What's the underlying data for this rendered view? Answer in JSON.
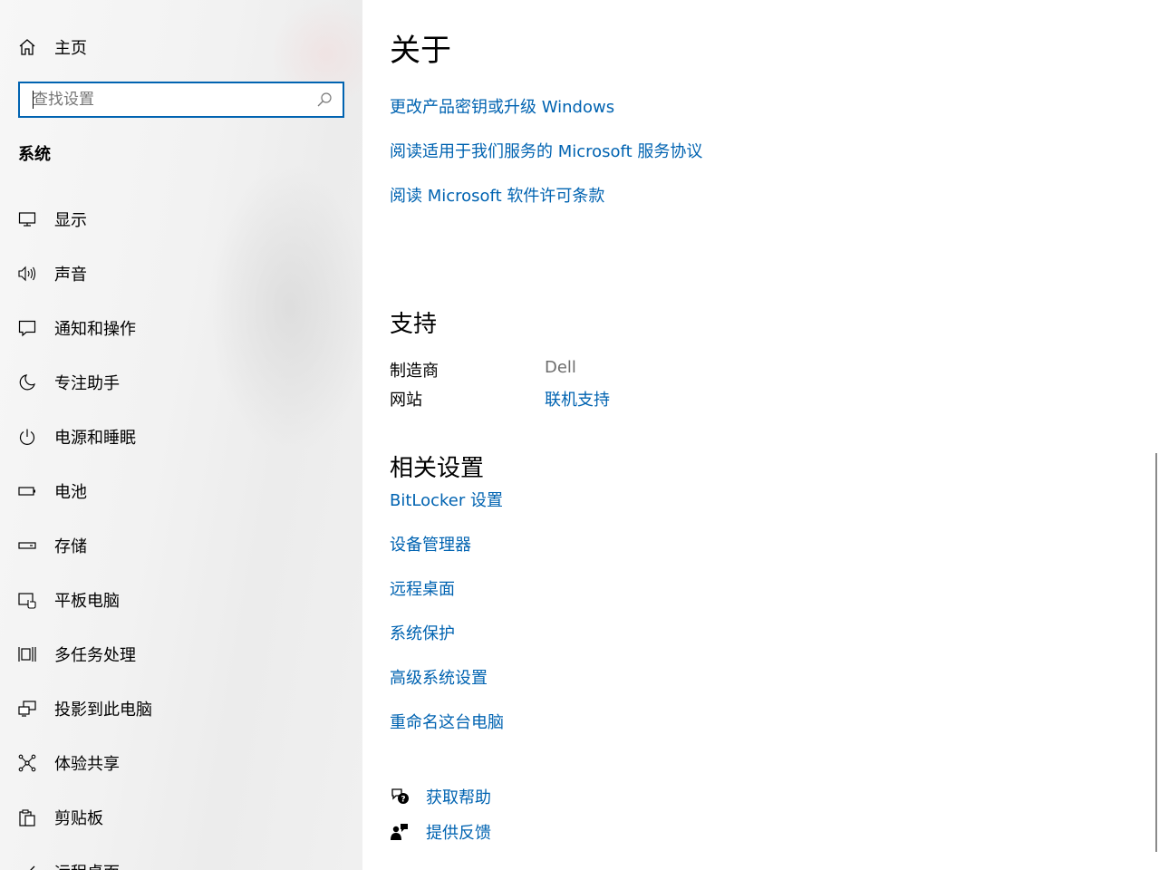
{
  "sidebar": {
    "home_label": "主页",
    "search_placeholder": "查找设置",
    "section_title": "系统",
    "items": [
      {
        "label": "显示",
        "icon": "monitor-icon"
      },
      {
        "label": "声音",
        "icon": "speaker-icon"
      },
      {
        "label": "通知和操作",
        "icon": "notification-icon"
      },
      {
        "label": "专注助手",
        "icon": "moon-icon"
      },
      {
        "label": "电源和睡眠",
        "icon": "power-icon"
      },
      {
        "label": "电池",
        "icon": "battery-icon"
      },
      {
        "label": "存储",
        "icon": "storage-icon"
      },
      {
        "label": "平板电脑",
        "icon": "tablet-icon"
      },
      {
        "label": "多任务处理",
        "icon": "multitask-icon"
      },
      {
        "label": "投影到此电脑",
        "icon": "project-icon"
      },
      {
        "label": "体验共享",
        "icon": "share-icon"
      },
      {
        "label": "剪贴板",
        "icon": "clipboard-icon"
      },
      {
        "label": "远程桌面",
        "icon": "remote-desktop-icon"
      }
    ]
  },
  "main": {
    "about_title": "关于",
    "about_links": [
      "更改产品密钥或升级 Windows",
      "阅读适用于我们服务的 Microsoft 服务协议",
      "阅读 Microsoft 软件许可条款"
    ],
    "support_title": "支持",
    "support": {
      "manufacturer_label": "制造商",
      "manufacturer_value": "Dell",
      "website_label": "网站",
      "website_value": "联机支持"
    },
    "related_title": "相关设置",
    "related_links": [
      "BitLocker 设置",
      "设备管理器",
      "远程桌面",
      "系统保护",
      "高级系统设置",
      "重命名这台电脑"
    ],
    "help": {
      "get_help": "获取帮助",
      "feedback": "提供反馈"
    }
  },
  "colors": {
    "accent": "#0063b1",
    "text": "#000000",
    "muted": "#6d6d6d"
  }
}
